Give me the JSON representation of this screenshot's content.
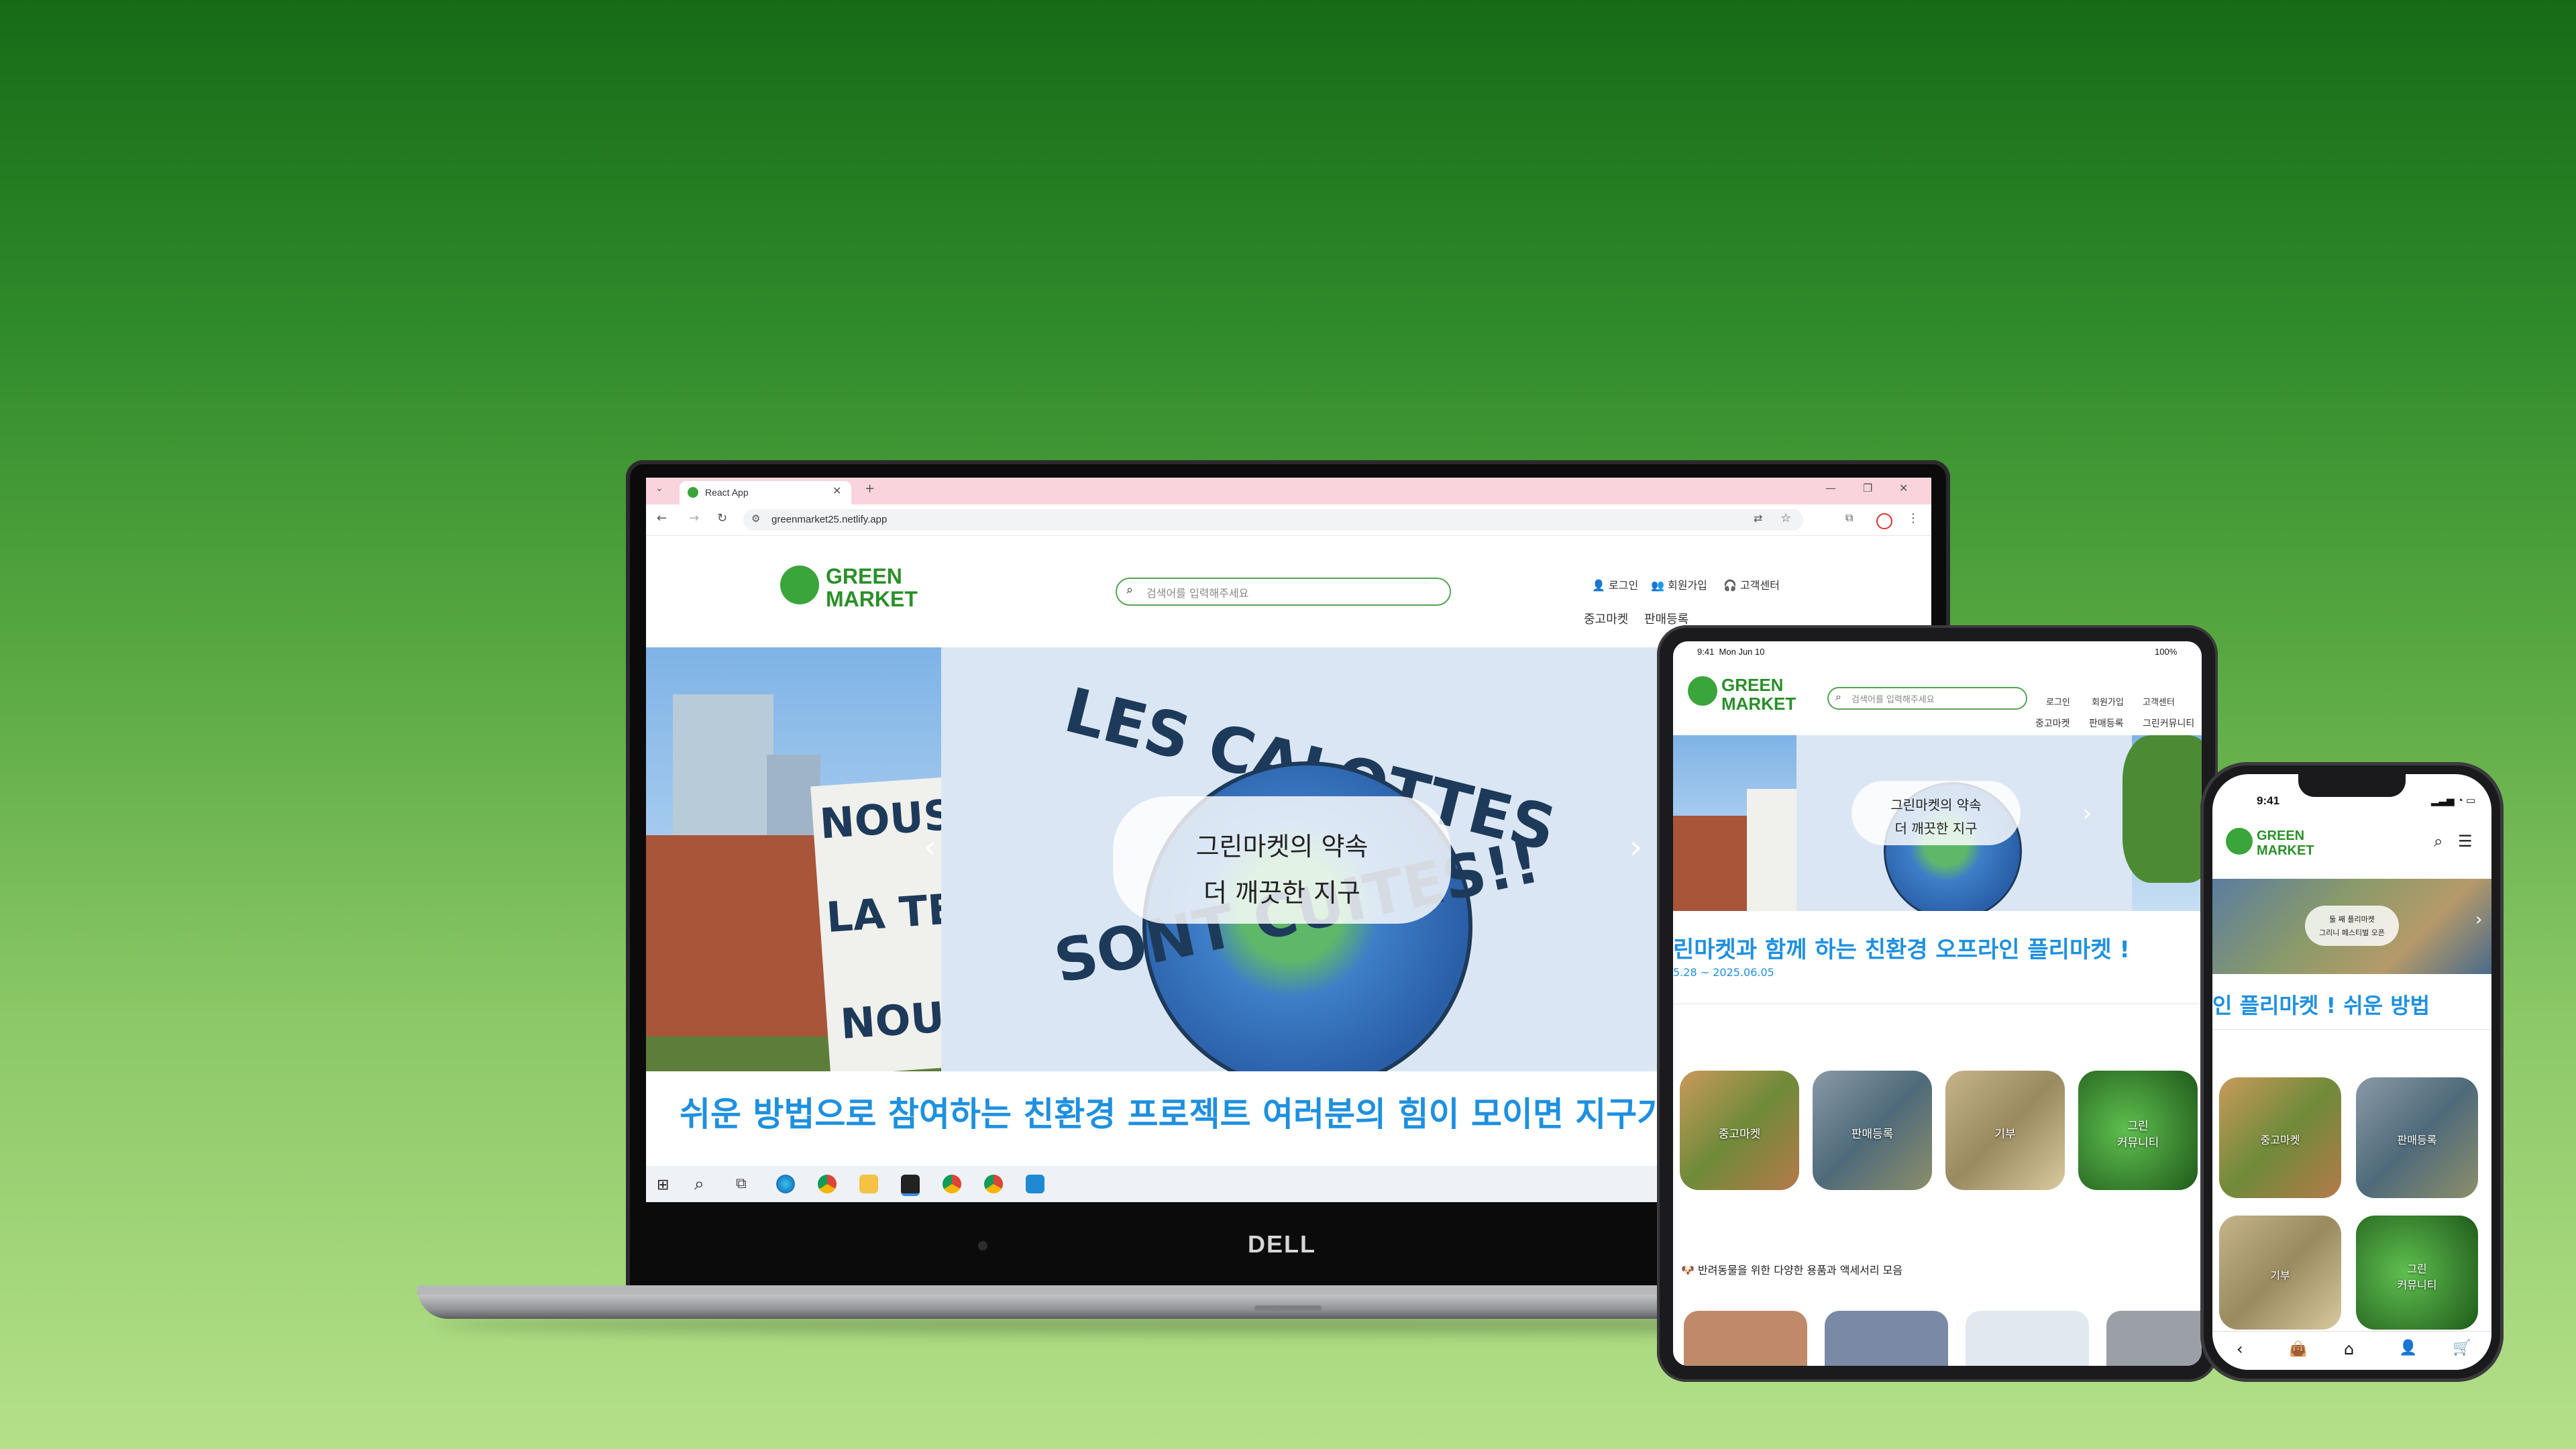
{
  "laptop": {
    "brand": "DELL",
    "browser": {
      "tab_title": "React App",
      "url": "greenmarket25.netlify.app"
    },
    "site": {
      "logo_line1": "GREEN",
      "logo_line2": "MARKET",
      "search_placeholder": "검색어를 입력해주세요",
      "top_links": [
        "로그인",
        "회원가입",
        "고객센터"
      ],
      "nav": [
        "중고마켓",
        "판매등록"
      ],
      "sign_main": "LES CALOTTES",
      "sign_bottom": "SONT CUITES!!",
      "sign_left": [
        "NOUS",
        "LA TE",
        "NOU"
      ],
      "hero_line1": "그린마켓의 약속",
      "hero_line2": "더 깨끗한 지구",
      "marquee": "쉬운 방법으로 참여하는 친환경 프로젝트 여러분의 힘이 모이면 지구가 깨"
    }
  },
  "tablet": {
    "status_time": "9:41",
    "status_date": "Mon Jun 10",
    "status_battery": "100%",
    "logo_line1": "GREEN",
    "logo_line2": "MARKET",
    "search_placeholder": "검색어를 입력해주세요",
    "top_links": [
      "로그인",
      "회원가입",
      "고객센터"
    ],
    "nav": [
      "중고마켓",
      "판매등록",
      "그린커뮤니티"
    ],
    "hero_line1": "그린마켓의 약속",
    "hero_line2": "더 깨끗한 지구",
    "marquee": "린마켓과 함께 하는 친환경 오프라인 플리마켓 !",
    "date_range": "5.28 ~ 2025.06.05",
    "categories": [
      "중고마켓",
      "판매등록",
      "기부",
      "그린\n커뮤니티"
    ],
    "section_title": "반려동물을 위한 다양한 용품과 액세서리 모음"
  },
  "phone": {
    "status_time": "9:41",
    "logo_line1": "GREEN",
    "logo_line2": "MARKET",
    "banner_line1": "둘 째 플리마켓",
    "banner_line2": "그리니 페스티벌 오픈",
    "marquee": "인 플리마켓 !      쉬운 방법",
    "categories": [
      "중고마켓",
      "판매등록",
      "기부",
      "그린\n커뮤니티"
    ]
  },
  "colors": {
    "brand_green": "#2a8f2a",
    "marquee_blue": "#1e90e0",
    "tab_pink": "#f9d4dc"
  }
}
